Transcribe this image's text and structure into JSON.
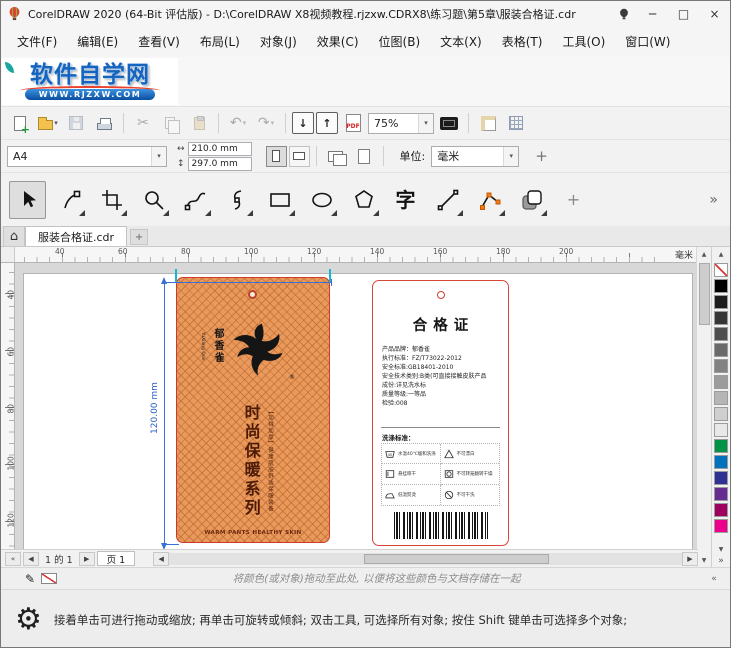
{
  "window": {
    "title": "CorelDRAW 2020 (64-Bit 评估版) - D:\\CorelDRAW X8视频教程.rjzxw.CDRX8\\练习题\\第5章\\服装合格证.cdr"
  },
  "glyphs": {
    "minimize": "─",
    "maximize": "□",
    "close": "×",
    "caret": "▾",
    "plus": "+",
    "chevrons": "»",
    "up": "▲",
    "down": "▼",
    "left": "◀",
    "right": "▶",
    "first": "«",
    "last": "»",
    "home": "⌂",
    "gear": "⚙",
    "pen": "✎",
    "scissors": "✂",
    "undo": "↶",
    "redo": "↷",
    "import": "↓",
    "export": "↑",
    "pdf": "PDF",
    "text_tool": "字",
    "h_arrow": "↔",
    "v_arrow": "↕"
  },
  "menu": {
    "items": [
      "文件(F)",
      "编辑(E)",
      "查看(V)",
      "布局(L)",
      "对象(J)",
      "效果(C)",
      "位图(B)",
      "文本(X)",
      "表格(T)",
      "工具(O)",
      "窗口(W)"
    ]
  },
  "logo": {
    "title": "软件自学网",
    "url": "WWW.RJZXW.COM"
  },
  "toolbar": {
    "zoom": "75%"
  },
  "propbar": {
    "preset": "A4",
    "width": "210.0 mm",
    "height": "297.0 mm",
    "units_label": "单位:",
    "units": "毫米"
  },
  "tabs": {
    "doc": "服装合格证.cdr"
  },
  "ruler": {
    "h_labels": [
      "40",
      "60",
      "80",
      "100",
      "120",
      "140",
      "160",
      "180",
      "200"
    ],
    "v_labels": [
      "40",
      "60",
      "80",
      "100",
      "120"
    ],
    "unit": "毫米"
  },
  "dimension": {
    "label": "120.00 mm"
  },
  "left_tag": {
    "brand_cn": "郁香雀",
    "brand_en": "YuXiang Que",
    "reg": "®",
    "title": "时尚保暖系列",
    "subtitle": "【加绒加厚】健康肌肤舒适保暖装备",
    "footer": "WARM PANTS HEALTHY SKIN"
  },
  "right_tag": {
    "title": "合格证",
    "info_lines": [
      "产品品牌：郁香雀",
      "执行标准：FZ/T73022-2012",
      "安全标准:GB18401-2010",
      "安全技术类别:B类(可直接接触皮肤产品",
      "成份:详见洗水标",
      "质量等级:一等品",
      "检验:008"
    ],
    "wash_title": "洗涤标准：",
    "care": [
      {
        "mark": "40",
        "label": "水温40℃缓和洗涤"
      },
      {
        "label": "不可漂白"
      },
      {
        "label": "悬挂晾干"
      },
      {
        "label": "不可转笼翻转干燥"
      },
      {
        "label": "低温熨烫"
      },
      {
        "label": "不可干洗"
      }
    ]
  },
  "pagenav": {
    "counter": "1 的 1",
    "page_tab": "页 1"
  },
  "palette": {
    "colors": [
      "none",
      "#000000",
      "#1c1c1c",
      "#363636",
      "#4f4f4f",
      "#696969",
      "#828282",
      "#9c9c9c",
      "#b5b5b5",
      "#cfcfcf",
      "#e8e8e8",
      "#009245",
      "#0071bc",
      "#2e3192",
      "#662d91",
      "#9e005d",
      "#ec008c"
    ]
  },
  "statusbar": {
    "drag_hint": "将颜色(或对象)拖动至此处, 以便将这些颜色与文档存储在一起",
    "tool_hint": "接着单击可进行拖动或缩放; 再单击可旋转或倾斜; 双击工具, 可选择所有对象; 按住 Shift 键单击可选择多个对象;"
  }
}
